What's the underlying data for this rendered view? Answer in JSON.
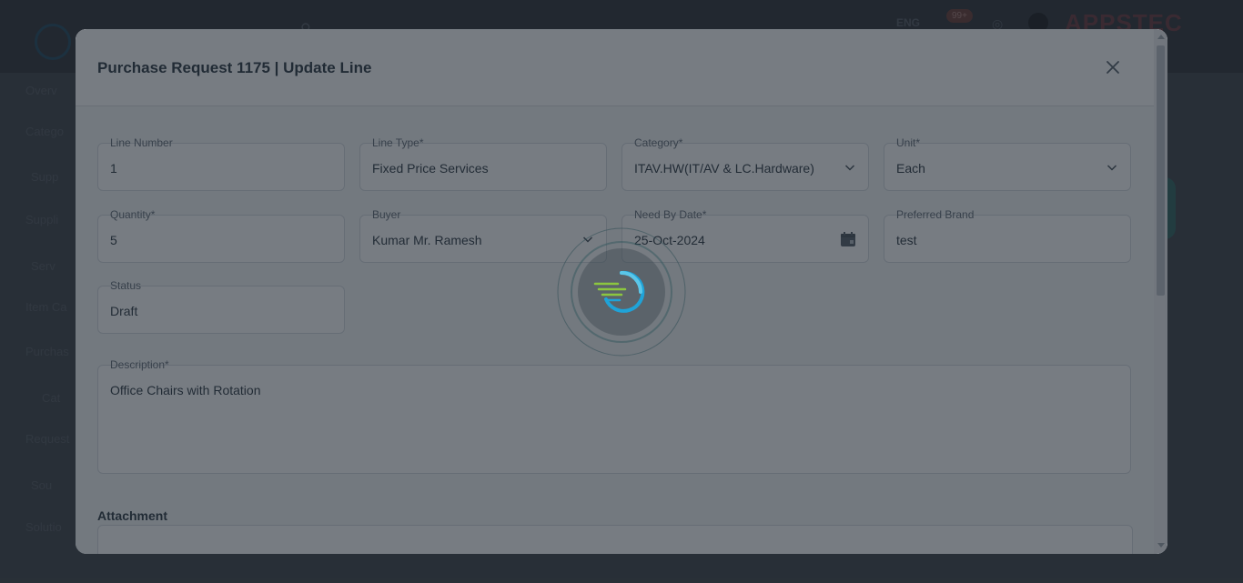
{
  "background_app": {
    "brand": "APPSTEC",
    "notification_badge": "99+",
    "language": "ENG",
    "side_labels": [
      "Overv",
      "Catego",
      "Supp",
      "Suppli",
      "Serv",
      "Item Ca",
      "Purchas",
      "Cat",
      "Request",
      "Sou",
      "Solutio"
    ]
  },
  "modal": {
    "title": "Purchase Request 1175 | Update Line",
    "fields": {
      "line_number": {
        "label": "Line Number",
        "value": "1"
      },
      "line_type": {
        "label": "Line Type*",
        "value": "Fixed Price Services"
      },
      "category": {
        "label": "Category*",
        "value": "ITAV.HW(IT/AV & LC.Hardware)"
      },
      "unit": {
        "label": "Unit*",
        "value": "Each"
      },
      "quantity": {
        "label": "Quantity*",
        "value": "5"
      },
      "buyer": {
        "label": "Buyer",
        "value": "Kumar Mr. Ramesh"
      },
      "need_by_date": {
        "label": "Need By Date*",
        "value": "25-Oct-2024"
      },
      "preferred_brand": {
        "label": "Preferred Brand",
        "value": "test"
      },
      "status": {
        "label": "Status",
        "value": "Draft"
      },
      "description": {
        "label": "Description*",
        "value": "Office Chairs with Rotation"
      }
    },
    "attachment_title": "Attachment"
  },
  "colors": {
    "scrim": "#1e252c",
    "loader_blue": "#1fa3d8",
    "loader_green": "#8cc63f"
  }
}
